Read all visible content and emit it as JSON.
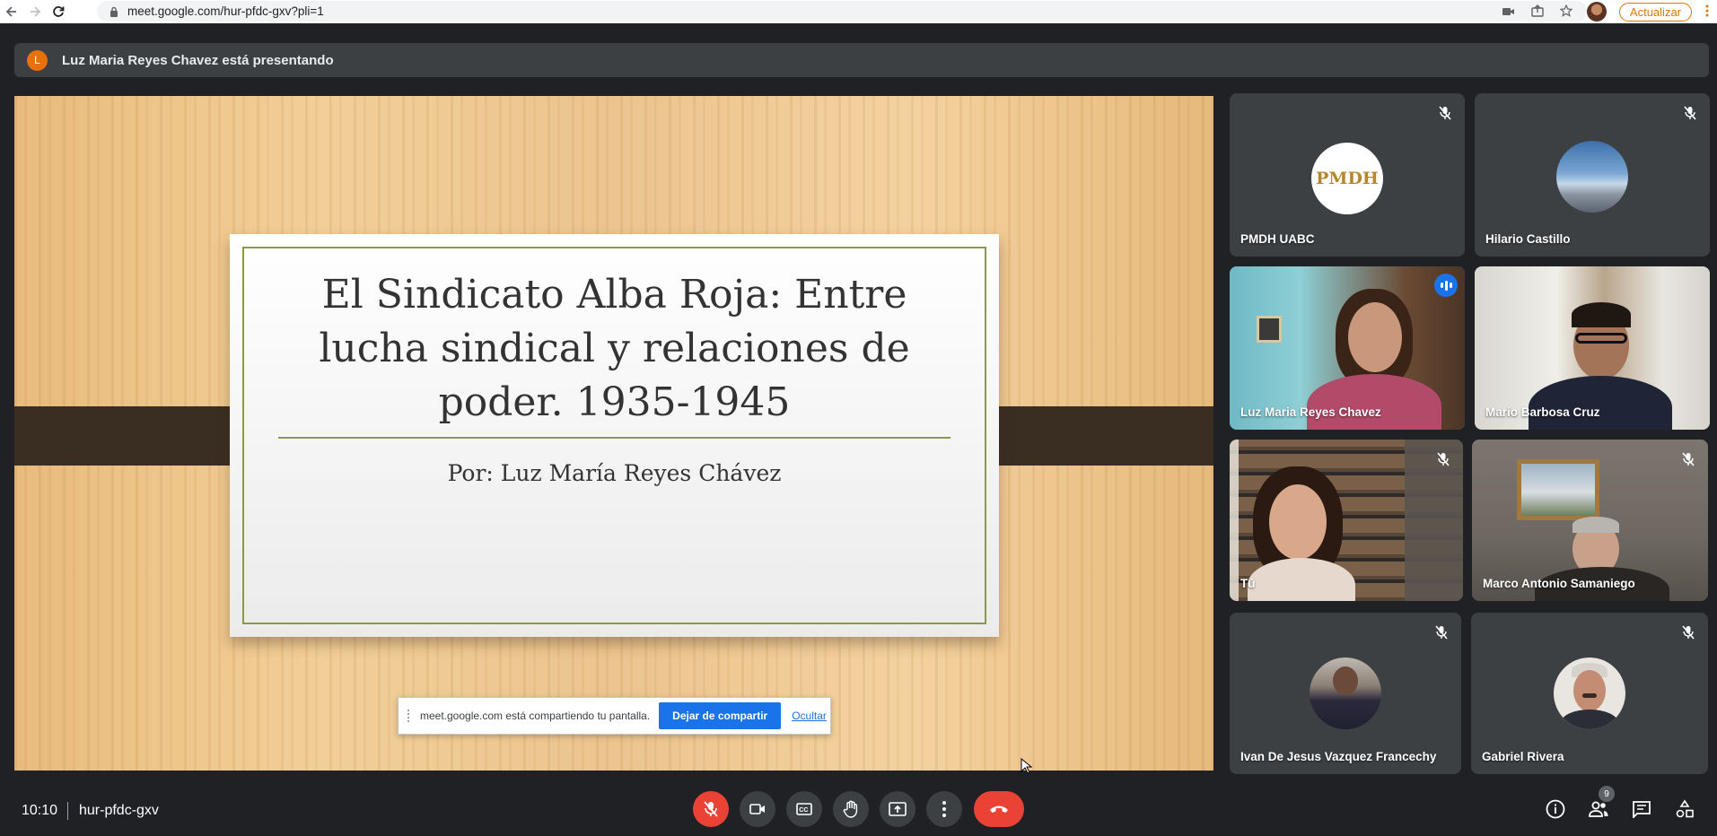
{
  "browser": {
    "url": "meet.google.com/hur-pfdc-gxv?pli=1",
    "update_label": "Actualizar"
  },
  "banner": {
    "avatar_letter": "L",
    "text": "Luz Maria Reyes Chavez está presentando"
  },
  "slide": {
    "title": "El Sindicato Alba Roja: Entre lucha sindical y relaciones de poder. 1935-1945",
    "subtitle": "Por: Luz María Reyes Chávez"
  },
  "share_toast": {
    "text": "meet.google.com está compartiendo tu pantalla.",
    "stop_label": "Dejar de compartir",
    "hide_label": "Ocultar"
  },
  "participants": [
    {
      "name": "PMDH UABC",
      "muted": true,
      "avatar_text": "PMDH"
    },
    {
      "name": "Hilario Castillo",
      "muted": true
    },
    {
      "name": "Luz Maria Reyes Chavez",
      "speaking": true
    },
    {
      "name": "Mario Barbosa Cruz"
    },
    {
      "name": "Tú",
      "muted": true
    },
    {
      "name": "Marco Antonio Samaniego",
      "muted": true
    },
    {
      "name": "Ivan De Jesus Vazquez Francechy",
      "muted": true
    },
    {
      "name": "Gabriel Rivera",
      "muted": true
    }
  ],
  "bottom": {
    "time": "10:10",
    "meeting_code": "hur-pfdc-gxv",
    "participant_count": "9"
  },
  "colors": {
    "background": "#202124",
    "tile": "#3c4043",
    "danger": "#ea4335",
    "accent": "#1a73e8",
    "orange": "#e8710a"
  },
  "icons": [
    "back-icon",
    "forward-icon",
    "reload-icon",
    "lock-icon",
    "mic-off-icon",
    "camera-icon",
    "captions-icon",
    "raise-hand-icon",
    "present-icon",
    "more-icon",
    "hangup-icon",
    "info-icon",
    "people-icon",
    "chat-icon",
    "activities-icon"
  ]
}
